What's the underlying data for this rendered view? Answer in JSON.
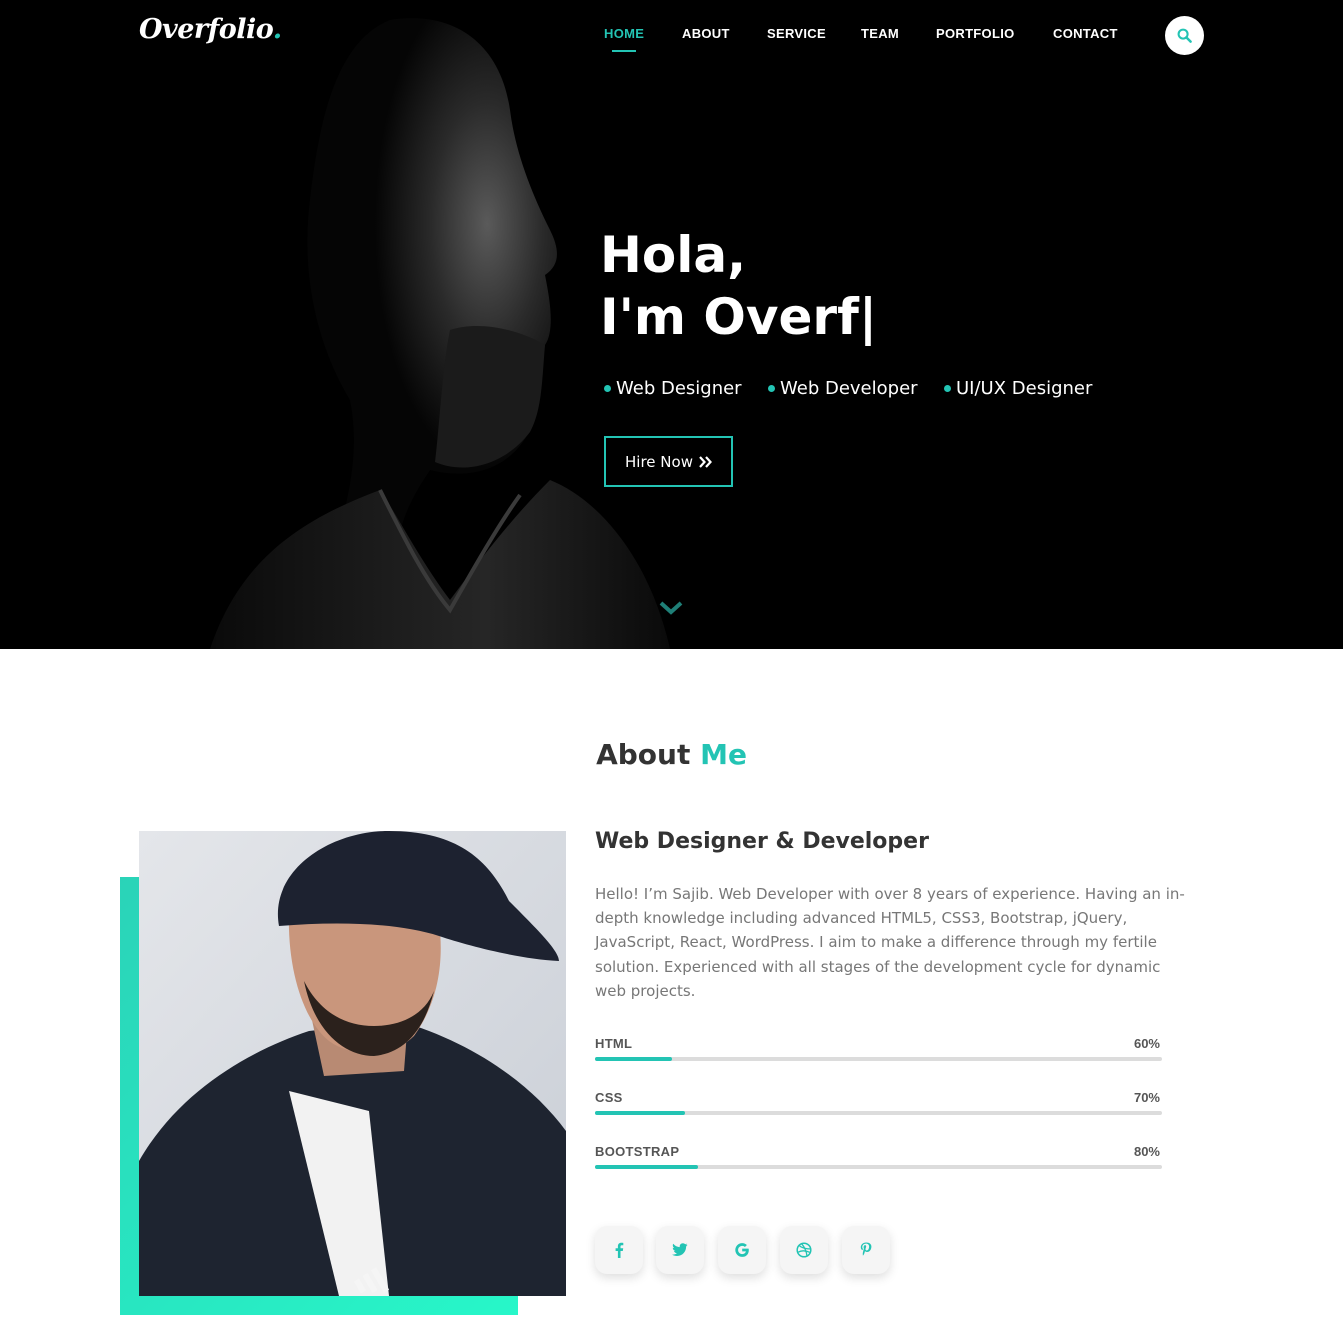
{
  "brand": {
    "logo_main": "Overfolio",
    "logo_dot": "."
  },
  "nav": {
    "items": [
      {
        "label": "HOME",
        "active": true
      },
      {
        "label": "ABOUT",
        "active": false
      },
      {
        "label": "SERVICE",
        "active": false
      },
      {
        "label": "TEAM",
        "active": false
      },
      {
        "label": "PORTFOLIO",
        "active": false
      },
      {
        "label": "CONTACT",
        "active": false
      }
    ],
    "search_icon": "search-icon"
  },
  "hero": {
    "greeting": "Hola,",
    "typed": "I'm Overf|",
    "roles": [
      "Web Designer",
      "Web Developer",
      "UI/UX Designer"
    ],
    "cta": "Hire Now",
    "cta_icon": "double-chevron-right-icon",
    "scroll_icon": "chevron-down-icon"
  },
  "about": {
    "heading_main": "About ",
    "heading_accent": "Me",
    "subtitle": "Web Designer & Developer",
    "bio": "Hello! I’m Sajib. Web Developer with over 8 years of experience. Having an in-depth knowledge including advanced HTML5, CSS3, Bootstrap, jQuery, JavaScript, React, WordPress. I aim to make a difference through my fertile solution. Experienced with all stages of the development cycle for dynamic web projects.",
    "skills": [
      {
        "name": "HTML",
        "percent_label": "60%",
        "percent": 60
      },
      {
        "name": "CSS",
        "percent_label": "70%",
        "percent": 70
      },
      {
        "name": "BOOTSTRAP",
        "percent_label": "80%",
        "percent": 80
      }
    ],
    "social": [
      "facebook-icon",
      "twitter-icon",
      "google-icon",
      "dribbble-icon",
      "pinterest-icon"
    ]
  },
  "colors": {
    "accent": "#23c4b4",
    "hero_bg": "#000000",
    "text_dark": "#333333",
    "text_muted": "#777777"
  }
}
